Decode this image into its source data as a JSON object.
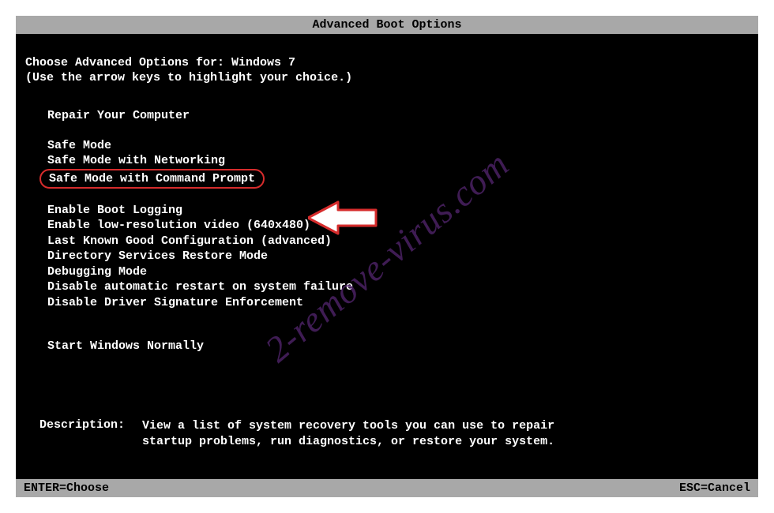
{
  "title": "Advanced Boot Options",
  "prompt": {
    "prefix": "Choose Advanced Options for: ",
    "os": "Windows 7",
    "hint": "(Use the arrow keys to highlight your choice.)"
  },
  "options": {
    "repair": "Repair Your Computer",
    "safe": "Safe Mode",
    "safe_net": "Safe Mode with Networking",
    "safe_cmd": "Safe Mode with Command Prompt",
    "bootlog": "Enable Boot Logging",
    "lowres": "Enable low-resolution video (640x480)",
    "lkgc": "Last Known Good Configuration (advanced)",
    "dsrm": "Directory Services Restore Mode",
    "debug": "Debugging Mode",
    "no_restart": "Disable automatic restart on system failure",
    "no_sig": "Disable Driver Signature Enforcement",
    "normal": "Start Windows Normally"
  },
  "description": {
    "label": "Description:",
    "text": "View a list of system recovery tools you can use to repair startup problems, run diagnostics, or restore your system."
  },
  "footer": {
    "enter": "ENTER=Choose",
    "esc": "ESC=Cancel"
  },
  "watermark": "2-remove-virus.com"
}
